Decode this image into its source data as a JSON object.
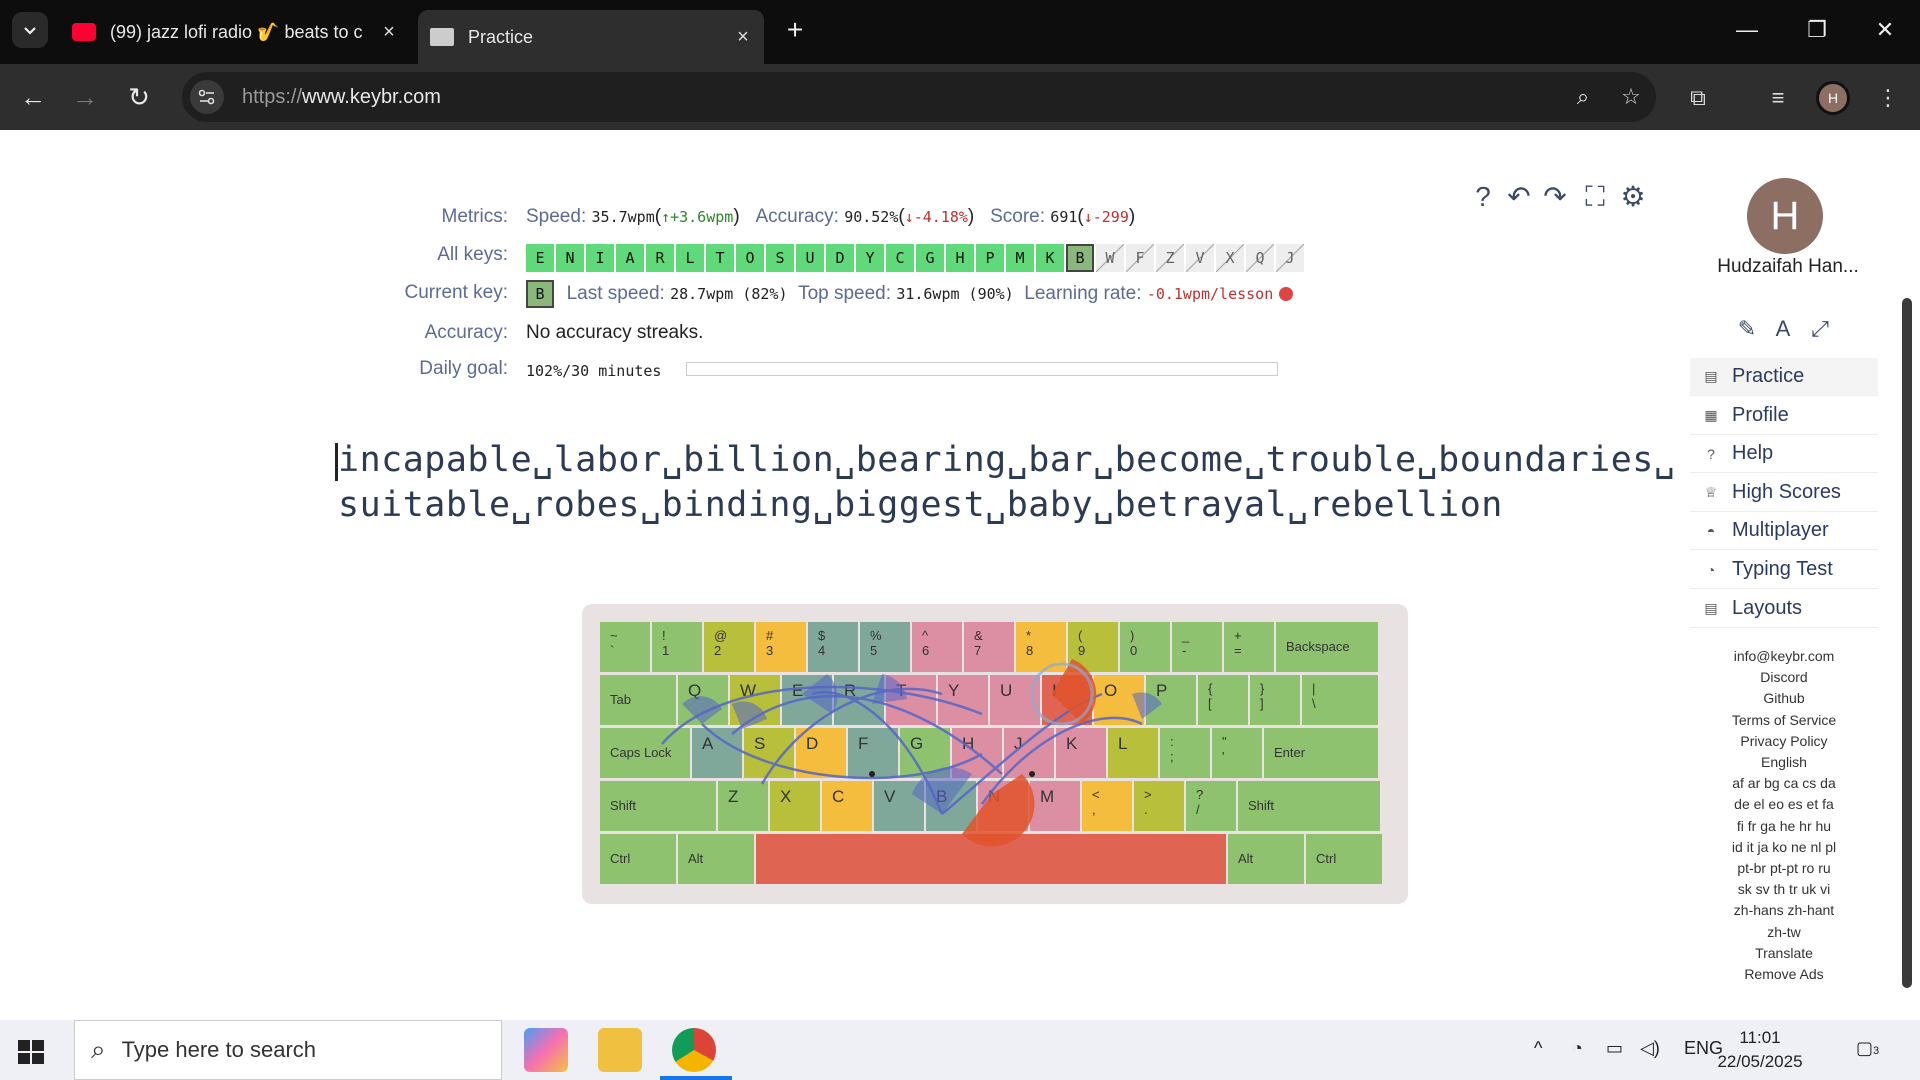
{
  "browser": {
    "tabs": [
      {
        "title": "(99) jazz lofi radio 🎷 beats to c",
        "close": "×"
      },
      {
        "title": "Practice",
        "close": "×"
      }
    ],
    "new_tab": "+",
    "url_scheme": "https://",
    "url_host": "www.keybr.com",
    "profile_initial": "H"
  },
  "metrics": {
    "metrics_label": "Metrics:",
    "speed_label": "Speed:",
    "speed_value": "35.7wpm",
    "speed_delta": "↑+3.6wpm",
    "accuracy_label": "Accuracy:",
    "accuracy_value": "90.52%",
    "accuracy_delta": "↓-4.18%",
    "score_label": "Score:",
    "score_value": "691",
    "score_delta": "↓-299",
    "all_keys_label": "All keys:",
    "keys": [
      {
        "k": "E",
        "s": "done"
      },
      {
        "k": "N",
        "s": "done"
      },
      {
        "k": "I",
        "s": "done"
      },
      {
        "k": "A",
        "s": "done"
      },
      {
        "k": "R",
        "s": "done"
      },
      {
        "k": "L",
        "s": "done"
      },
      {
        "k": "T",
        "s": "done"
      },
      {
        "k": "O",
        "s": "done"
      },
      {
        "k": "S",
        "s": "done"
      },
      {
        "k": "U",
        "s": "done"
      },
      {
        "k": "D",
        "s": "done"
      },
      {
        "k": "Y",
        "s": "done"
      },
      {
        "k": "C",
        "s": "done"
      },
      {
        "k": "G",
        "s": "done"
      },
      {
        "k": "H",
        "s": "done"
      },
      {
        "k": "P",
        "s": "done"
      },
      {
        "k": "M",
        "s": "done"
      },
      {
        "k": "K",
        "s": "done"
      },
      {
        "k": "B",
        "s": "cur"
      },
      {
        "k": "W",
        "s": "locked"
      },
      {
        "k": "F",
        "s": "locked"
      },
      {
        "k": "Z",
        "s": "locked"
      },
      {
        "k": "V",
        "s": "locked"
      },
      {
        "k": "X",
        "s": "locked"
      },
      {
        "k": "Q",
        "s": "locked"
      },
      {
        "k": "J",
        "s": "locked"
      }
    ],
    "current_key_label": "Current key:",
    "current_key": "B",
    "last_speed_label": "Last speed:",
    "last_speed": "28.7wpm (82%)",
    "top_speed_label": "Top speed:",
    "top_speed": "31.6wpm (90%)",
    "learning_rate_label": "Learning rate:",
    "learning_rate": "-0.1wpm/lesson",
    "accuracy_streak_label": "Accuracy:",
    "accuracy_streak": "No accuracy streaks.",
    "daily_goal_label": "Daily goal:",
    "daily_goal": "102%/30 minutes",
    "daily_goal_progress": 1.0
  },
  "practice": {
    "line1": "incapable␣labor␣billion␣bearing␣bar␣become␣trouble␣boundaries␣",
    "line2": "suitable␣robes␣binding␣biggest␣baby␣betrayal␣rebellion"
  },
  "keyboard": {
    "rows": [
      [
        [
          "~\n`",
          ""
        ],
        [
          "!\n1",
          ""
        ],
        [
          "@\n2",
          ""
        ],
        [
          "#\n3",
          ""
        ],
        [
          "$\n4",
          ""
        ],
        [
          "%\n5",
          ""
        ],
        [
          "^\n6",
          ""
        ],
        [
          "&\n7",
          ""
        ],
        [
          "*\n8",
          ""
        ],
        [
          "(\n9",
          ""
        ],
        [
          ")\n0",
          ""
        ],
        [
          "_\n-",
          ""
        ],
        [
          "+\n=",
          ""
        ],
        [
          "Backspace",
          ""
        ]
      ],
      [
        [
          "Tab",
          ""
        ],
        [
          "Q",
          ""
        ],
        [
          "W",
          ""
        ],
        [
          "E",
          ""
        ],
        [
          "R",
          ""
        ],
        [
          "T",
          ""
        ],
        [
          "Y",
          ""
        ],
        [
          "U",
          ""
        ],
        [
          "I",
          ""
        ],
        [
          "O",
          ""
        ],
        [
          "P",
          ""
        ],
        [
          "{\n[",
          ""
        ],
        [
          "}\n]",
          ""
        ],
        [
          "|\n\\",
          ""
        ]
      ],
      [
        [
          "Caps Lock",
          ""
        ],
        [
          "A",
          ""
        ],
        [
          "S",
          ""
        ],
        [
          "D",
          ""
        ],
        [
          "F",
          ""
        ],
        [
          "G",
          ""
        ],
        [
          "H",
          ""
        ],
        [
          "J",
          ""
        ],
        [
          "K",
          ""
        ],
        [
          "L",
          ""
        ],
        [
          ":\n;",
          ""
        ],
        [
          "\"\n'",
          ""
        ],
        [
          "Enter",
          ""
        ]
      ],
      [
        [
          "Shift",
          ""
        ],
        [
          "Z",
          ""
        ],
        [
          "X",
          ""
        ],
        [
          "C",
          ""
        ],
        [
          "V",
          ""
        ],
        [
          "B",
          ""
        ],
        [
          "N",
          ""
        ],
        [
          "M",
          ""
        ],
        [
          "<\n,",
          ""
        ],
        [
          ">\n.",
          ""
        ],
        [
          "?\n/",
          ""
        ],
        [
          "Shift",
          ""
        ]
      ],
      [
        [
          "Ctrl",
          ""
        ],
        [
          "Alt",
          ""
        ],
        [
          "",
          ""
        ],
        [
          "Alt",
          ""
        ],
        [
          "Ctrl",
          ""
        ]
      ]
    ],
    "colors": {
      "green": "#8fc26f",
      "olive": "#b8bf3a",
      "teal": "#7fa89a",
      "pink": "#dc8fa3",
      "orange": "#f5bd3d",
      "red": "#e06452"
    }
  },
  "user": {
    "initial": "H",
    "name": "Hudzaifah Han..."
  },
  "nav": [
    {
      "label": "Practice",
      "icon": "keyboard-icon"
    },
    {
      "label": "Profile",
      "icon": "chart-icon"
    },
    {
      "label": "Help",
      "icon": "help-icon"
    },
    {
      "label": "High Scores",
      "icon": "trophy-icon"
    },
    {
      "label": "Multiplayer",
      "icon": "car-icon"
    },
    {
      "label": "Typing Test",
      "icon": "gauge-icon"
    },
    {
      "label": "Layouts",
      "icon": "keyboard-icon"
    }
  ],
  "footer": [
    "info@keybr.com",
    "Discord",
    "Github",
    "Terms of Service",
    "Privacy Policy",
    "English",
    "af ar bg ca cs da",
    "de el eo es et fa",
    "fi fr ga he hr hu",
    "id it ja ko ne nl pl",
    "pt-br pt-pt ro ru",
    "sk sv th tr uk vi",
    "zh-hans zh-hant",
    "zh-tw",
    "Translate",
    "Remove Ads"
  ],
  "taskbar": {
    "search_placeholder": "Type here to search",
    "lang": "ENG",
    "time": "11:01",
    "date": "22/05/2025",
    "notifications": "3"
  }
}
